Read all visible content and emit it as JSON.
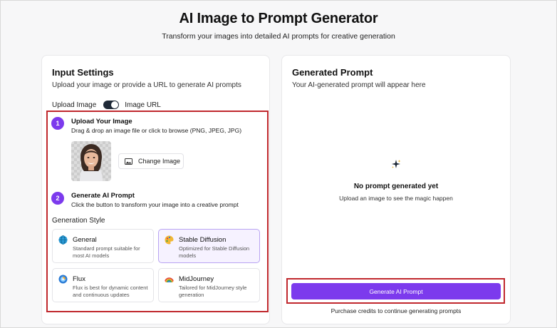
{
  "header": {
    "title": "AI Image to Prompt Generator",
    "subtitle": "Transform your images into detailed AI prompts for creative generation"
  },
  "input_settings": {
    "title": "Input Settings",
    "description": "Upload your image or provide a URL to generate AI prompts",
    "toggle_left": "Upload Image",
    "toggle_right": "Image URL",
    "step1": {
      "number": "1",
      "title": "Upload Your Image",
      "description": "Drag & drop an image file or click to browse (PNG, JPEG, JPG)"
    },
    "change_image_label": "Change Image",
    "step2": {
      "number": "2",
      "title": "Generate AI Prompt",
      "description": "Click the button to transform your image into a creative prompt"
    },
    "generation_style_label": "Generation Style",
    "styles": [
      {
        "name": "General",
        "description": "Standard prompt suitable for most AI models",
        "icon": "globe-icon",
        "color": "#2fa3e0",
        "selected": false
      },
      {
        "name": "Stable Diffusion",
        "description": "Optimized for Stable Diffusion models",
        "icon": "palette-icon",
        "color": "#f2b733",
        "selected": true
      },
      {
        "name": "Flux",
        "description": "Flux is best for dynamic content and continuous updates",
        "icon": "flux-icon",
        "color": "#2b7cd6",
        "selected": false
      },
      {
        "name": "MidJourney",
        "description": "Tailored for MidJourney style generation",
        "icon": "rainbow-icon",
        "color": "#e0463c",
        "selected": false
      }
    ]
  },
  "generated_prompt": {
    "title": "Generated Prompt",
    "description": "Your AI-generated prompt will appear here",
    "empty_title": "No prompt generated yet",
    "empty_description": "Upload an image to see the magic happen",
    "button_label": "Generate AI Prompt",
    "purchase_note": "Purchase credits to continue generating prompts"
  },
  "colors": {
    "accent": "#7c3aed",
    "highlight": "#c0282d"
  }
}
